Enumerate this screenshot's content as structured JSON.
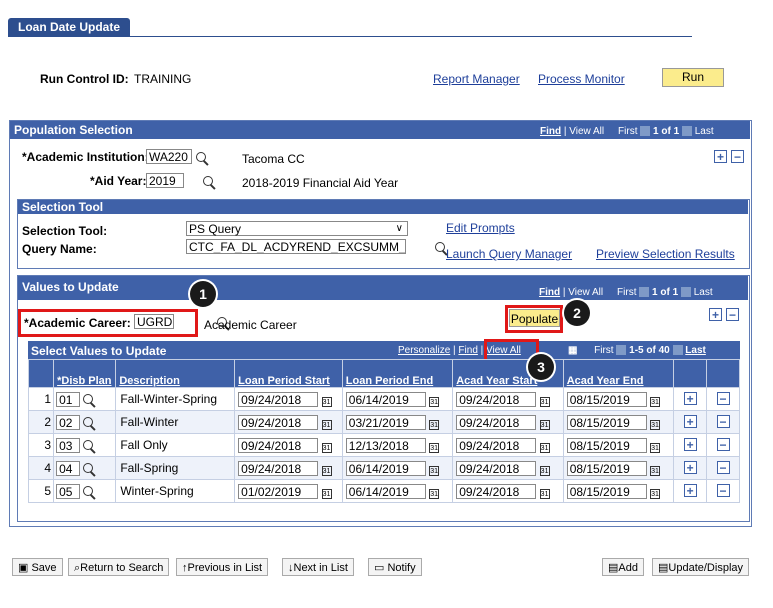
{
  "tab": {
    "label": "Loan Date Update"
  },
  "run_control": {
    "label": "Run Control ID:",
    "value": "TRAINING"
  },
  "top_links": {
    "report_manager": "Report Manager",
    "process_monitor": "Process Monitor",
    "run": "Run"
  },
  "population": {
    "header": "Population Selection",
    "nav": {
      "find": "Find",
      "sep": "|",
      "view_all": "View All",
      "first": "First",
      "count": "1 of 1",
      "last": "Last"
    },
    "institution_label": "*Academic Institution:",
    "institution_value": "WA220",
    "institution_desc": "Tacoma CC",
    "aid_year_label": "*Aid Year:",
    "aid_year_value": "2019",
    "aid_year_desc": "2018-2019 Financial Aid Year"
  },
  "selection_tool": {
    "header": "Selection Tool",
    "tool_label": "Selection Tool:",
    "tool_value": "PS Query",
    "query_label": "Query Name:",
    "query_value": "CTC_FA_DL_ACDYREND_EXCSUMM_T",
    "edit_prompts": "Edit Prompts",
    "launch": "Launch Query Manager",
    "preview": "Preview Selection Results"
  },
  "values": {
    "header": "Values to Update",
    "nav": {
      "find": "Find",
      "sep": "|",
      "view_all": "View All",
      "first": "First",
      "count": "1 of 1",
      "last": "Last"
    },
    "career_label": "*Academic Career:",
    "career_value": "UGRD",
    "career_desc": "Academic Career",
    "populate": "Populate"
  },
  "grid": {
    "header": "Select Values to Update",
    "personalize": "Personalize",
    "find": "Find",
    "view_all": "View All",
    "first": "First",
    "count": "1-5 of 40",
    "last": "Last",
    "columns": [
      "*Disb Plan",
      "Description",
      "Loan Period Start",
      "Loan Period End",
      "Acad Year Start",
      "Acad Year End"
    ],
    "rows": [
      {
        "n": "1",
        "plan": "01",
        "desc": "Fall-Winter-Spring",
        "lps": "09/24/2018",
        "lpe": "06/14/2019",
        "ays": "09/24/2018",
        "aye": "08/15/2019"
      },
      {
        "n": "2",
        "plan": "02",
        "desc": "Fall-Winter",
        "lps": "09/24/2018",
        "lpe": "03/21/2019",
        "ays": "09/24/2018",
        "aye": "08/15/2019"
      },
      {
        "n": "3",
        "plan": "03",
        "desc": "Fall Only",
        "lps": "09/24/2018",
        "lpe": "12/13/2018",
        "ays": "09/24/2018",
        "aye": "08/15/2019"
      },
      {
        "n": "4",
        "plan": "04",
        "desc": "Fall-Spring",
        "lps": "09/24/2018",
        "lpe": "06/14/2019",
        "ays": "09/24/2018",
        "aye": "08/15/2019"
      },
      {
        "n": "5",
        "plan": "05",
        "desc": "Winter-Spring",
        "lps": "01/02/2019",
        "lpe": "06/14/2019",
        "ays": "09/24/2018",
        "aye": "08/15/2019"
      }
    ]
  },
  "callouts": [
    "1",
    "2",
    "3"
  ],
  "bottom": {
    "save": "Save",
    "return": "Return to Search",
    "previous": "Previous in List",
    "next": "Next in List",
    "notify": "Notify",
    "add": "Add",
    "update": "Update/Display"
  }
}
